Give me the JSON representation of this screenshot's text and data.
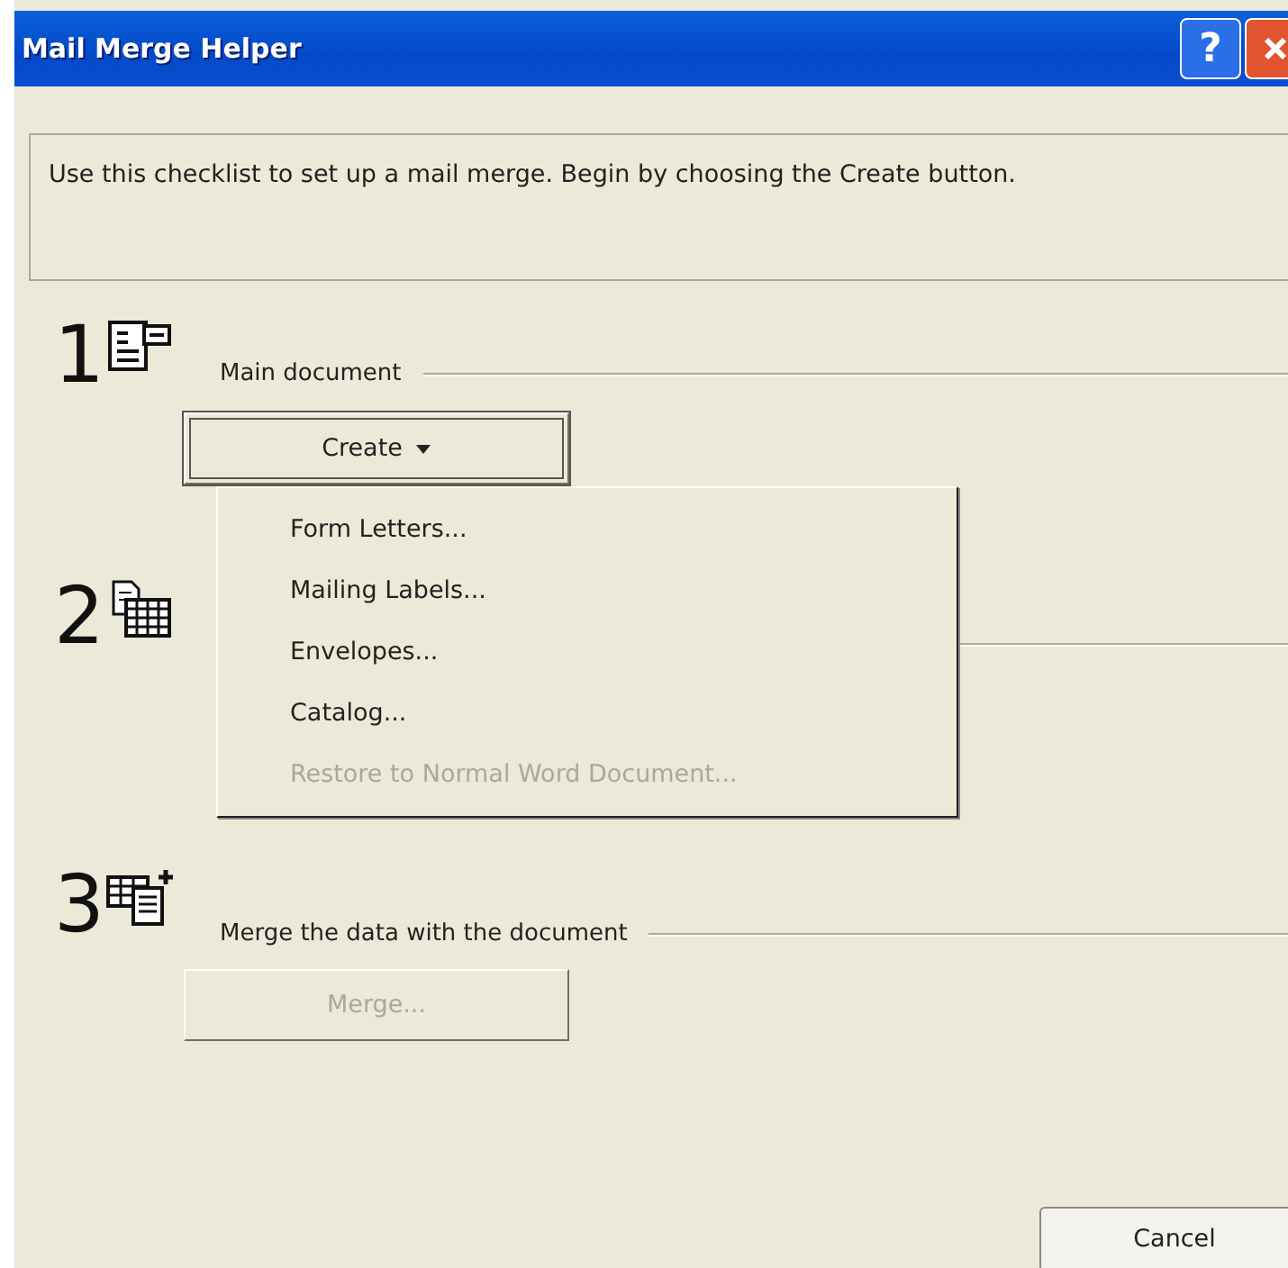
{
  "window": {
    "title": "Mail Merge Helper",
    "title_buttons": [
      {
        "kind": "help",
        "label": "?"
      },
      {
        "kind": "close"
      }
    ]
  },
  "intro": "Use this checklist to set up a mail merge. Begin by choosing the Create button.",
  "steps": [
    {
      "number": "1",
      "kind": "main",
      "label": "Main document",
      "button": {
        "label": "Create",
        "dropdown": true,
        "disabled": false,
        "focused": true
      }
    },
    {
      "number": "2",
      "kind": "data"
    },
    {
      "number": "3",
      "kind": "merge",
      "label": "Merge the data with the document",
      "button": {
        "label": "Merge...",
        "dropdown": false,
        "disabled": true,
        "focused": false
      }
    }
  ],
  "menu": [
    {
      "label": "Form Letters...",
      "disabled": false
    },
    {
      "label": "Mailing Labels...",
      "disabled": false
    },
    {
      "label": "Envelopes...",
      "disabled": false
    },
    {
      "label": "Catalog...",
      "disabled": false
    },
    {
      "label": "Restore to Normal Word Document...",
      "disabled": true
    }
  ],
  "buttons": [
    {
      "label": "Cancel"
    }
  ]
}
